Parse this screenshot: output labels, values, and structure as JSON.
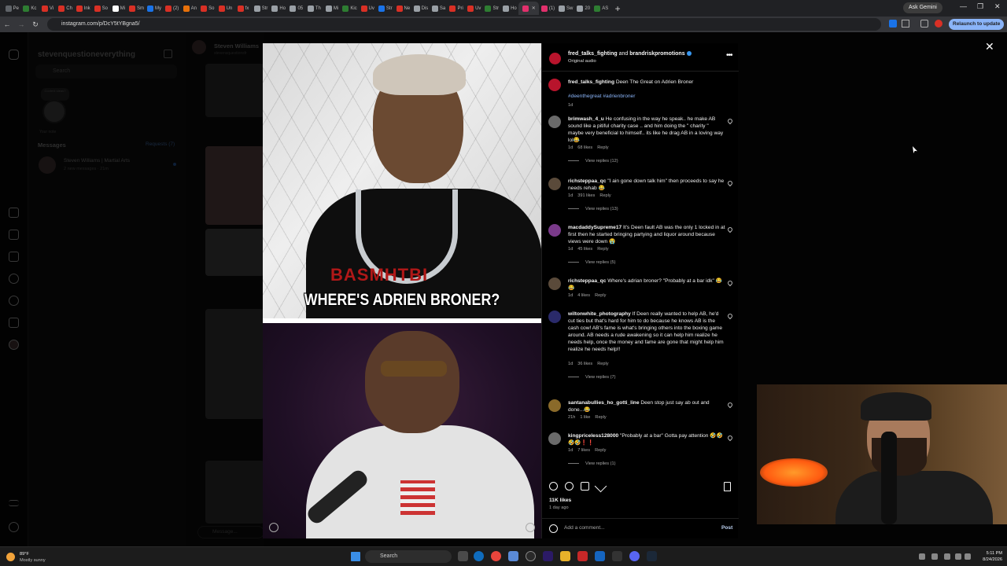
{
  "browser": {
    "tabs": [
      {
        "label": "Pe",
        "color": "#5f6368"
      },
      {
        "label": "Kc",
        "color": "#2e7d32"
      },
      {
        "label": "Vi",
        "color": "#d93025"
      },
      {
        "label": "Ch",
        "color": "#d93025"
      },
      {
        "label": "Ink",
        "color": "#d93025"
      },
      {
        "label": "So",
        "color": "#d93025"
      },
      {
        "label": "Mi",
        "color": "#ffffff"
      },
      {
        "label": "Sm",
        "color": "#d93025"
      },
      {
        "label": "My",
        "color": "#1a73e8"
      },
      {
        "label": "(2)",
        "color": "#d93025"
      },
      {
        "label": "An",
        "color": "#e8710a"
      },
      {
        "label": "So",
        "color": "#d93025"
      },
      {
        "label": "Un",
        "color": "#d93025"
      },
      {
        "label": "fx",
        "color": "#d93025"
      },
      {
        "label": "Str",
        "color": "#9aa0a6"
      },
      {
        "label": "Ho",
        "color": "#9aa0a6"
      },
      {
        "label": "05",
        "color": "#9aa0a6"
      },
      {
        "label": "Th",
        "color": "#9aa0a6"
      },
      {
        "label": "Mi",
        "color": "#9aa0a6"
      },
      {
        "label": "Kic",
        "color": "#2e7d32"
      },
      {
        "label": "Uv",
        "color": "#d93025"
      },
      {
        "label": "Str",
        "color": "#1a73e8"
      },
      {
        "label": "Ne",
        "color": "#d93025"
      },
      {
        "label": "Dis",
        "color": "#9aa0a6"
      },
      {
        "label": "Sa",
        "color": "#9aa0a6"
      },
      {
        "label": "Pri",
        "color": "#d93025"
      },
      {
        "label": "Uv",
        "color": "#d93025"
      },
      {
        "label": "Str",
        "color": "#2e7d32"
      },
      {
        "label": "Ho",
        "color": "#9aa0a6"
      },
      {
        "label": "",
        "color": "#e1306c",
        "active": true
      },
      {
        "label": "(1)",
        "color": "#e1306c"
      },
      {
        "label": "Sw",
        "color": "#9aa0a6"
      },
      {
        "label": "20",
        "color": "#9aa0a6"
      },
      {
        "label": "AS",
        "color": "#2e7d32"
      }
    ],
    "ask_gemini": "Ask Gemini",
    "url": "instagram.com/p/DcY5tYBgna5/",
    "relaunch": "Relaunch to update"
  },
  "dm": {
    "username": "stevenquestioneverything",
    "search_placeholder": "Search",
    "note": "Content ideas?",
    "note_sub": "Your note",
    "messages_label": "Messages",
    "requests_label": "Requests (7)",
    "thread": {
      "name": "Steven Williams | Martial Arts",
      "preview": "2 new messages · 21m"
    }
  },
  "chat": {
    "name": "Steven Williams",
    "handle": "stevensquestionsfr",
    "input_placeholder": "Message..."
  },
  "media": {
    "caption": "WHERE'S ADRIEN BRONER?",
    "shirt_text": "BASMHTBI"
  },
  "post": {
    "header_user1": "fred_talks_fighting",
    "header_and": " and ",
    "header_user2": "brandriskpromotions",
    "audio": "Original audio",
    "caption_user": "fred_talks_fighting",
    "caption_text": " Deen The Great on Adrien Broner",
    "caption_tags": "#deenthegreat #adrienbroner",
    "caption_time": "1d",
    "comments": [
      {
        "user": "brimwash_4_u",
        "text": " He confusing in the way he speak.. he make AB sound like a pitiful charity case .. and him doing the \" charity \" maybe very beneficial to himself.. its like he drag AB in a loving way lol😂",
        "time": "1d",
        "likes": "68 likes",
        "reply": "Reply",
        "replies": "View replies (12)",
        "color": "#6a6a6a"
      },
      {
        "user": "richsteppaa_qc",
        "text": " \"I ain gone down talk him\" then proceeds to say he needs rehab 😂",
        "time": "1d",
        "likes": "391 likes",
        "reply": "Reply",
        "replies": "View replies (13)",
        "color": "#5a4a3a"
      },
      {
        "user": "macdaddySupreme17",
        "text": " It's Deen fault AB was the only 1 locked in at first then he started bringing partying and liquor around because views were down 😭",
        "time": "1d",
        "likes": "45 likes",
        "reply": "Reply",
        "replies": "View replies (5)",
        "color": "#7a3a8a"
      },
      {
        "user": "richsteppaa_qc",
        "text": " Where's adrian broner? \"Probably at a bar idk\" 😂😂",
        "time": "1d",
        "likes": "4 likes",
        "reply": "Reply",
        "replies": "",
        "color": "#5a4a3a"
      },
      {
        "user": "wiltonwhite_photography",
        "text": " If Deen really wanted to help AB, he'd cut ties but that's hard for him to do because he knows AB is the cash cow! AB's fame is what's bringing others into the boxing game around. AB needs a rude awakening so it can help him realize he needs help, once the money and fame are gone that might help him realize he needs help!!",
        "time": "1d",
        "likes": "36 likes",
        "reply": "Reply",
        "replies": "View replies (7)",
        "color": "#2a2a6a"
      },
      {
        "user": "santanabullies_ho_gotti_line",
        "text": " Deen stop just say ab out and done...😂",
        "time": "21h",
        "likes": "1 like",
        "reply": "Reply",
        "replies": "",
        "color": "#8a6a2a"
      },
      {
        "user": "kingpriceless128000",
        "text": " \"Probably at a bar\" Gotta pay attention 🤣🤣🤣🤣❗❗",
        "time": "1d",
        "likes": "7 likes",
        "reply": "Reply",
        "replies": "View replies (1)",
        "color": "#6a6a6a"
      }
    ],
    "likes_total": "11K likes",
    "posted": "1 day ago",
    "add_comment": "Add a comment...",
    "post_button": "Post"
  },
  "taskbar": {
    "temp": "89°F",
    "weather": "Mostly sunny",
    "search": "Search",
    "time": "5:11 PM",
    "date": "8/24/2026"
  }
}
